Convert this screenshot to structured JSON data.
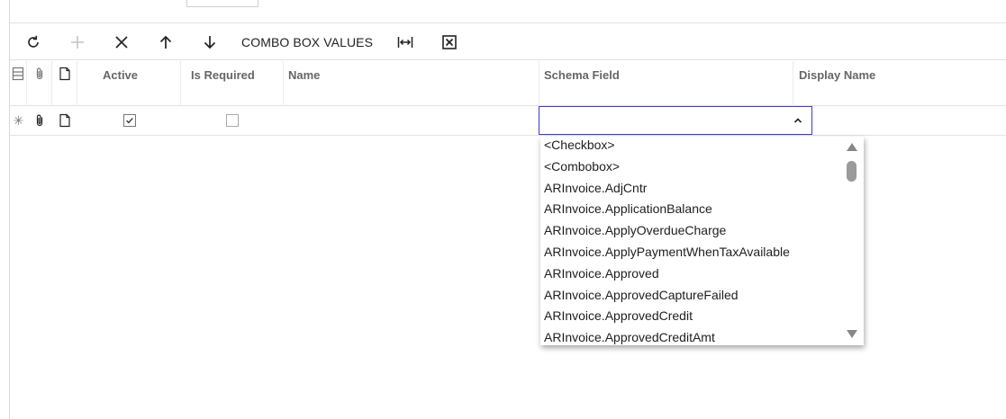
{
  "top_strip": {
    "partial_text": ""
  },
  "toolbar": {
    "refresh_icon": "refresh-icon",
    "add_icon": "plus-icon",
    "delete_icon": "close-icon",
    "up_icon": "arrow-up-icon",
    "down_icon": "arrow-down-icon",
    "combo_values_label": "COMBO BOX VALUES",
    "fit_icon": "fit-columns-icon",
    "excel_icon": "excel-export-icon"
  },
  "grid": {
    "columns": {
      "active": "Active",
      "is_required": "Is Required",
      "name": "Name",
      "schema_field": "Schema Field",
      "display_name": "Display Name"
    },
    "new_row": {
      "marker": "✳",
      "active_checked": true,
      "is_required_checked": false,
      "name": "",
      "schema_field": "",
      "display_name": ""
    }
  },
  "dropdown": {
    "options": [
      "<Checkbox>",
      "<Combobox>",
      "ARInvoice.AdjCntr",
      "ARInvoice.ApplicationBalance",
      "ARInvoice.ApplyOverdueCharge",
      "ARInvoice.ApplyPaymentWhenTaxAvailable",
      "ARInvoice.Approved",
      "ARInvoice.ApprovedCaptureFailed",
      "ARInvoice.ApprovedCredit",
      "ARInvoice.ApprovedCreditAmt"
    ]
  },
  "colors": {
    "accent_border": "#3a3ad6",
    "header_text": "#666666",
    "grid_line": "#e3e3e3"
  }
}
